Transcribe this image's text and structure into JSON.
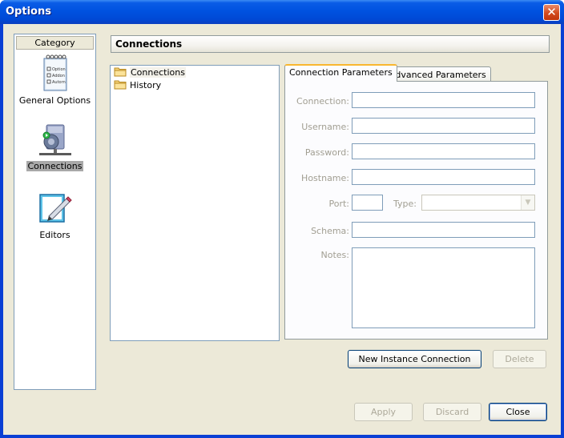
{
  "window": {
    "title": "Options",
    "close_glyph": "✕"
  },
  "category": {
    "header": "Category",
    "items": [
      {
        "label": "General Options",
        "icon": "general-options-icon",
        "selected": false
      },
      {
        "label": "Connections",
        "icon": "connections-icon",
        "selected": true
      },
      {
        "label": "Editors",
        "icon": "editors-icon",
        "selected": false
      }
    ],
    "general_icon_lines": [
      "Option",
      "Addon",
      "Autorn"
    ]
  },
  "section_title": "Connections",
  "tree": {
    "items": [
      {
        "label": "Connections",
        "selected": true
      },
      {
        "label": "History",
        "selected": false
      }
    ]
  },
  "tabs": [
    {
      "label": "Connection Parameters",
      "active": true
    },
    {
      "label": "Advanced Parameters",
      "active": false
    }
  ],
  "form": {
    "connection_label": "Connection:",
    "connection_value": "",
    "username_label": "Username:",
    "username_value": "",
    "password_label": "Password:",
    "password_value": "",
    "hostname_label": "Hostname:",
    "hostname_value": "",
    "port_label": "Port:",
    "port_value": "",
    "type_label": "Type:",
    "type_value": "",
    "schema_label": "Schema:",
    "schema_value": "",
    "notes_label": "Notes:",
    "notes_value": ""
  },
  "buttons": {
    "new_instance": "New Instance Connection",
    "delete": "Delete",
    "apply": "Apply",
    "discard": "Discard",
    "close": "Close"
  },
  "colors": {
    "title_bar": "#0052e0",
    "dialog_bg": "#ece9d8",
    "field_border": "#7f9db9",
    "active_tab_accent": "#f9b72f",
    "disabled_text": "#aca899"
  }
}
